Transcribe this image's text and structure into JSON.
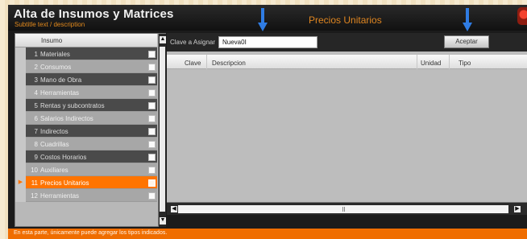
{
  "window": {
    "title": "Alta de Insumos y Matrices",
    "subtitle": "Subtitle text / description",
    "section_title": "Precios Unitarios"
  },
  "left_list": {
    "column_header": "Insumo",
    "items": [
      {
        "num": "1",
        "label": "Materiales",
        "style": "dark"
      },
      {
        "num": "2",
        "label": "Consumos",
        "style": "light"
      },
      {
        "num": "3",
        "label": "Mano de Obra",
        "style": "dark"
      },
      {
        "num": "4",
        "label": "Herramientas",
        "style": "light"
      },
      {
        "num": "5",
        "label": "Rentas y subcontratos",
        "style": "dark"
      },
      {
        "num": "6",
        "label": "Salarios Indirectos",
        "style": "light"
      },
      {
        "num": "7",
        "label": "Indirectos",
        "style": "dark"
      },
      {
        "num": "8",
        "label": "Cuadrillas",
        "style": "light"
      },
      {
        "num": "9",
        "label": "Costos Horarios",
        "style": "dark"
      },
      {
        "num": "10",
        "label": "Auxiliares",
        "style": "light"
      },
      {
        "num": "11",
        "label": "Precios Unitarios",
        "style": "selected"
      },
      {
        "num": "12",
        "label": "Herramientas",
        "style": "light"
      }
    ]
  },
  "toolbar": {
    "code_label": "Clave a Asignar",
    "code_value": "Nueva0I",
    "accept_label": "Aceptar"
  },
  "grid": {
    "columns": [
      "Clave",
      "Descripcion",
      "Unidad",
      "Tipo"
    ]
  },
  "status": {
    "text": "En esta parte, únicamente puede agregar los tipos indicados."
  },
  "colors": {
    "accent": "#ef6d00",
    "selected_row": "#ff7400",
    "arrow": "#2f7ce3"
  }
}
